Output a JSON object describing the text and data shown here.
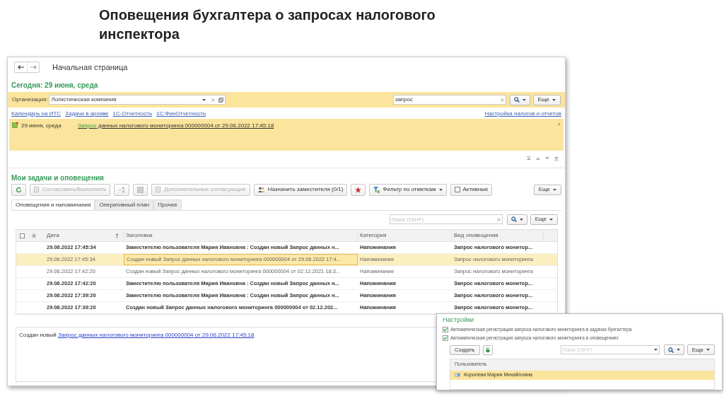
{
  "slide_title": "Оповещения бухгалтера о запросах налогового инспектора",
  "window": {
    "title": "Начальная страница"
  },
  "today": "Сегодня: 29 июня, среда",
  "filter": {
    "org_label": "Организация:",
    "org_value": "Логистическая компания",
    "search_value": "запрос",
    "more": "Еще"
  },
  "links": [
    "Календарь на ИТС",
    "Задачи в архиве",
    "1С-Отчетность",
    "1С:ФинОтчетность"
  ],
  "settings_link": "Настройка налогов и отчетов",
  "notification": {
    "date": "29 июня, среда",
    "link_lead": "Запрос",
    "link_text": "данных налогового мониторинга 000000004 от 29.06.2022 17:45:18",
    "close": "×"
  },
  "section_title": "Мои задачи и оповещения",
  "toolbar": [
    {
      "kind": "refresh",
      "disabled": false
    },
    {
      "kind": "text",
      "label": "Согласовать/Выполнить",
      "disabled": true
    },
    {
      "kind": "sort",
      "disabled": true
    },
    {
      "kind": "grid",
      "disabled": true
    },
    {
      "kind": "text",
      "label": "Дополнительные согласующие",
      "disabled": true
    },
    {
      "kind": "text",
      "label": "Назначить заместителя (0/1)",
      "disabled": false
    },
    {
      "kind": "star",
      "disabled": false
    },
    {
      "kind": "filter",
      "label": "Фильтр по отметкам",
      "disabled": false
    },
    {
      "kind": "check",
      "label": "Активные",
      "disabled": false
    }
  ],
  "toolbar_more": "Еще",
  "tabs": [
    {
      "label": "Оповещения и напоминания",
      "selected": true
    },
    {
      "label": "Оперативный план",
      "selected": false
    },
    {
      "label": "Прочее",
      "selected": false
    }
  ],
  "list_search": {
    "placeholder": "Поиск (Ctrl+F)"
  },
  "list_more": "Еще",
  "table": {
    "columns": [
      "Дата",
      "Заголовок",
      "Категория",
      "Вид оповещения"
    ],
    "rows": [
      {
        "date": "29.06.2022 17:45:34",
        "title": "Заместителю пользователя Мария Ивановна : Создан новый Запрос данных н...",
        "category": "Напоминания",
        "type": "Запрос налогового монитор...",
        "unread": true,
        "selected": false
      },
      {
        "date": "29.06.2022 17:45:34",
        "title": "Создан новый Запрос данных налогового мониторинга 000000004 от 29.06.2022 17:4...",
        "category": "Напоминания",
        "type": "Запрос налогового мониторинга",
        "unread": false,
        "selected": true
      },
      {
        "date": "29.06.2022 17:42:20",
        "title": "Создан новый Запрос данных налогового мониторинга 000000004 от 02.12.2021 18:3...",
        "category": "Напоминания",
        "type": "Запрос налогового мониторинга",
        "unread": false,
        "selected": false
      },
      {
        "date": "29.06.2022 17:42:20",
        "title": "Заместителю пользователя Мария Ивановна : Создан новый Запрос данных н...",
        "category": "Напоминания",
        "type": "Запрос налогового монитор...",
        "unread": true,
        "selected": false
      },
      {
        "date": "29.06.2022 17:39:20",
        "title": "Заместителю пользователя Мария Ивановна : Создан новый Запрос данных н...",
        "category": "Напоминания",
        "type": "Запрос налогового монитор...",
        "unread": true,
        "selected": false
      },
      {
        "date": "29.06.2022 17:39:20",
        "title": "Создан новый Запрос данных налогового мониторинга 000000004 от 02.12.202...",
        "category": "Напоминания",
        "type": "Запрос налогового монитор...",
        "unread": true,
        "selected": false
      }
    ]
  },
  "preview": {
    "lead": "Создан новый",
    "link": "Запрос данных налогового мониторинга 000000004 от 29.06.2022 17:45:18"
  },
  "settings_panel": {
    "title": "Настройки",
    "options": [
      {
        "label": "Автоматическая регистрация запроса налогового мониторинга в задачах бухгалтера",
        "checked": true
      },
      {
        "label": "Автоматическая регистрация запроса налогового мониторинга в оповещениях",
        "checked": true
      }
    ],
    "create": "Создать",
    "search": {
      "placeholder": "Поиск (Ctrl+F)"
    },
    "more": "Еще",
    "column": "Пользователь",
    "users": [
      {
        "name": "Королева Мария Михайловна",
        "selected": true
      }
    ]
  }
}
